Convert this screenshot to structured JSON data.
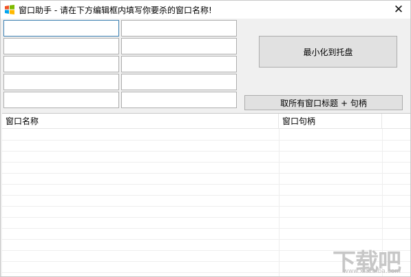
{
  "window": {
    "title": "窗口助手 - 请在下方编辑框内填写你要杀的窗口名称!",
    "close_glyph": "✕"
  },
  "edits": [
    {
      "value": ""
    },
    {
      "value": ""
    },
    {
      "value": ""
    },
    {
      "value": ""
    },
    {
      "value": ""
    },
    {
      "value": ""
    },
    {
      "value": ""
    },
    {
      "value": ""
    },
    {
      "value": ""
    },
    {
      "value": ""
    }
  ],
  "buttons": {
    "minimize_to_tray": "最小化到托盘",
    "get_all_titles": "取所有窗口标题 + 句柄"
  },
  "listview": {
    "columns": [
      "窗口名称",
      "窗口句柄",
      ""
    ],
    "rows": []
  },
  "watermark": {
    "text": "下载吧",
    "url": "www.xiazaiba.com"
  }
}
